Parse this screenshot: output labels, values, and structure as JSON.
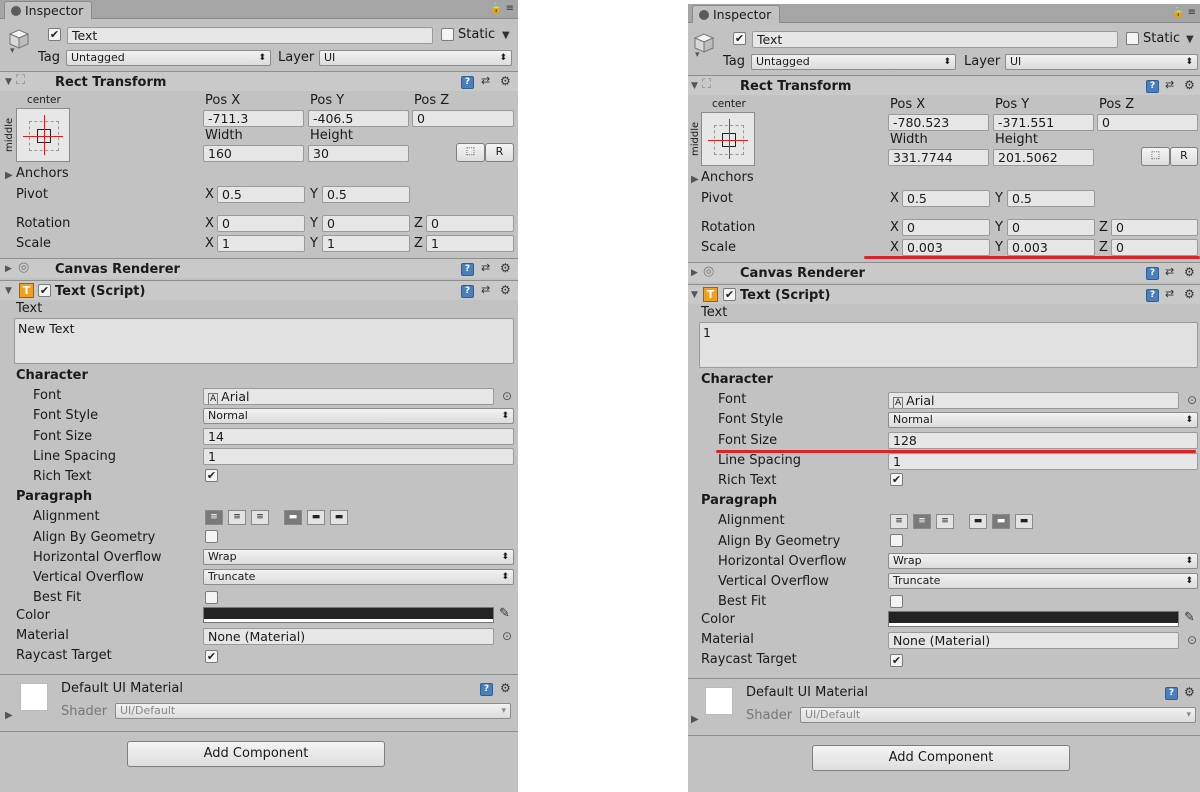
{
  "shared": {
    "tab_title": "Inspector",
    "object_name": "Text",
    "static_label": "Static",
    "tag_label": "Tag",
    "tag_value": "Untagged",
    "layer_label": "Layer",
    "layer_value": "UI",
    "rect_transform": "Rect Transform",
    "anchor_preset_top": "center",
    "anchor_preset_side": "middle",
    "pos_x_label": "Pos X",
    "pos_y_label": "Pos Y",
    "pos_z_label": "Pos Z",
    "width_label": "Width",
    "height_label": "Height",
    "r_button": "R",
    "anchors": "Anchors",
    "pivot": "Pivot",
    "rotation": "Rotation",
    "scale": "Scale",
    "x": "X",
    "y": "Y",
    "z": "Z",
    "canvas_renderer": "Canvas Renderer",
    "text_script": "Text (Script)",
    "text_label": "Text",
    "character": "Character",
    "font": "Font",
    "font_value": "Arial",
    "font_style": "Font Style",
    "font_style_value": "Normal",
    "font_size": "Font Size",
    "line_spacing": "Line Spacing",
    "rich_text": "Rich Text",
    "paragraph": "Paragraph",
    "alignment": "Alignment",
    "align_by_geometry": "Align By Geometry",
    "horizontal_overflow": "Horizontal Overflow",
    "horizontal_overflow_value": "Wrap",
    "vertical_overflow": "Vertical Overflow",
    "vertical_overflow_value": "Truncate",
    "best_fit": "Best Fit",
    "color": "Color",
    "material": "Material",
    "material_value": "None (Material)",
    "raycast_target": "Raycast Target",
    "default_ui_material": "Default UI Material",
    "shader": "Shader",
    "shader_value": "UI/Default",
    "add_component": "Add Component"
  },
  "left": {
    "pos_x": "-711.3",
    "pos_y": "-406.5",
    "pos_z": "0",
    "width": "160",
    "height": "30",
    "pivot_x": "0.5",
    "pivot_y": "0.5",
    "rot_x": "0",
    "rot_y": "0",
    "rot_z": "0",
    "scale_x": "1",
    "scale_y": "1",
    "scale_z": "1",
    "text_value": "New Text",
    "font_size_value": "14",
    "line_spacing_value": "1"
  },
  "right": {
    "pos_x": "-780.523",
    "pos_y": "-371.551",
    "pos_z": "0",
    "width": "331.7744",
    "height": "201.5062",
    "pivot_x": "0.5",
    "pivot_y": "0.5",
    "rot_x": "0",
    "rot_y": "0",
    "rot_z": "0",
    "scale_x": "0.003",
    "scale_y": "0.003",
    "scale_z": "0",
    "text_value": "1",
    "font_size_value": "128",
    "line_spacing_value": "1"
  },
  "colors": {
    "panel_bg": "#c2c2c2",
    "annotation_red": "#d8252b",
    "help_blue": "#4a7fbd"
  }
}
